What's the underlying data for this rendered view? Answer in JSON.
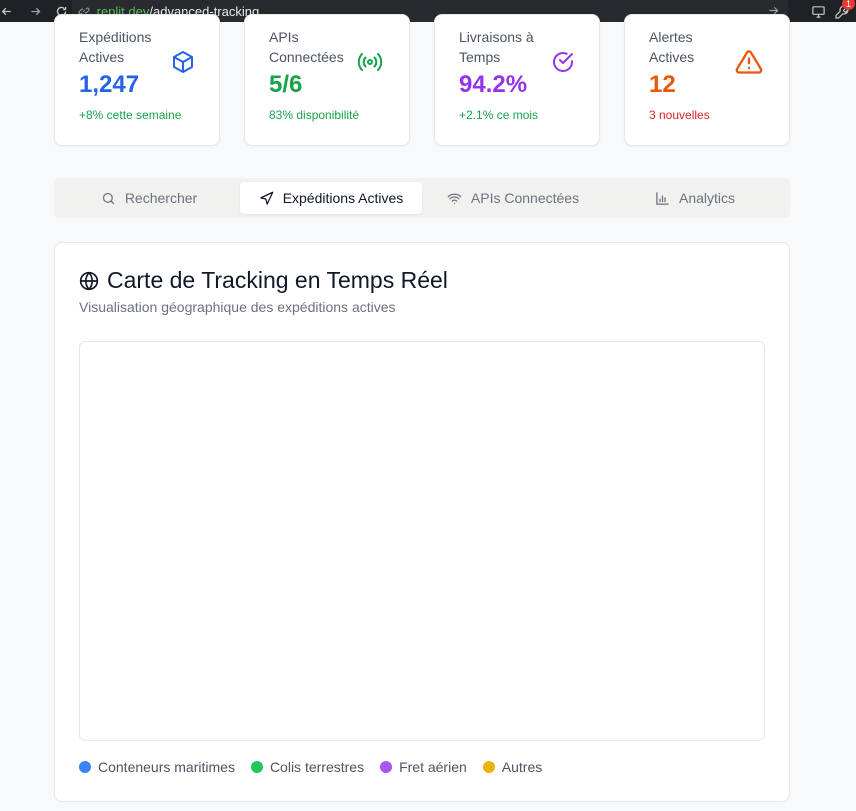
{
  "browser": {
    "url_domain_prefix": ".replit.dev",
    "url_path": "/advanced-tracking",
    "badge_count": "1"
  },
  "stats": [
    {
      "title": "Expéditions Actives",
      "value": "1,247",
      "sub": "+8% cette semaine",
      "icon": "package-icon",
      "value_color": "#2563eb",
      "sub_color": "#16a34a",
      "icon_color": "#2563eb"
    },
    {
      "title": "APIs Connectées",
      "value": "5/6",
      "sub": "83% disponibilité",
      "icon": "signal-icon",
      "value_color": "#16a34a",
      "sub_color": "#16a34a",
      "icon_color": "#16a34a"
    },
    {
      "title": "Livraisons à Temps",
      "value": "94.2%",
      "sub": "+2.1% ce mois",
      "icon": "check-circle-icon",
      "value_color": "#9333ea",
      "sub_color": "#16a34a",
      "icon_color": "#9333ea"
    },
    {
      "title": "Alertes Actives",
      "value": "12",
      "sub": "3 nouvelles",
      "icon": "warning-icon",
      "value_color": "#ea580c",
      "sub_color": "#dc2626",
      "icon_color": "#ea580c"
    }
  ],
  "tabs": [
    {
      "label": "Rechercher",
      "icon": "search-icon",
      "active": false
    },
    {
      "label": "Expéditions Actives",
      "icon": "navigation-icon",
      "active": true
    },
    {
      "label": "APIs Connectées",
      "icon": "wifi-icon",
      "active": false
    },
    {
      "label": "Analytics",
      "icon": "bar-chart-icon",
      "active": false
    }
  ],
  "map": {
    "title": "Carte de Tracking en Temps Réel",
    "description": "Visualisation géographique des expéditions actives",
    "legend": [
      {
        "label": "Conteneurs maritimes",
        "color": "#3b82f6"
      },
      {
        "label": "Colis terrestres",
        "color": "#22c55e"
      },
      {
        "label": "Fret aérien",
        "color": "#a855f7"
      },
      {
        "label": "Autres",
        "color": "#eab308"
      }
    ]
  }
}
